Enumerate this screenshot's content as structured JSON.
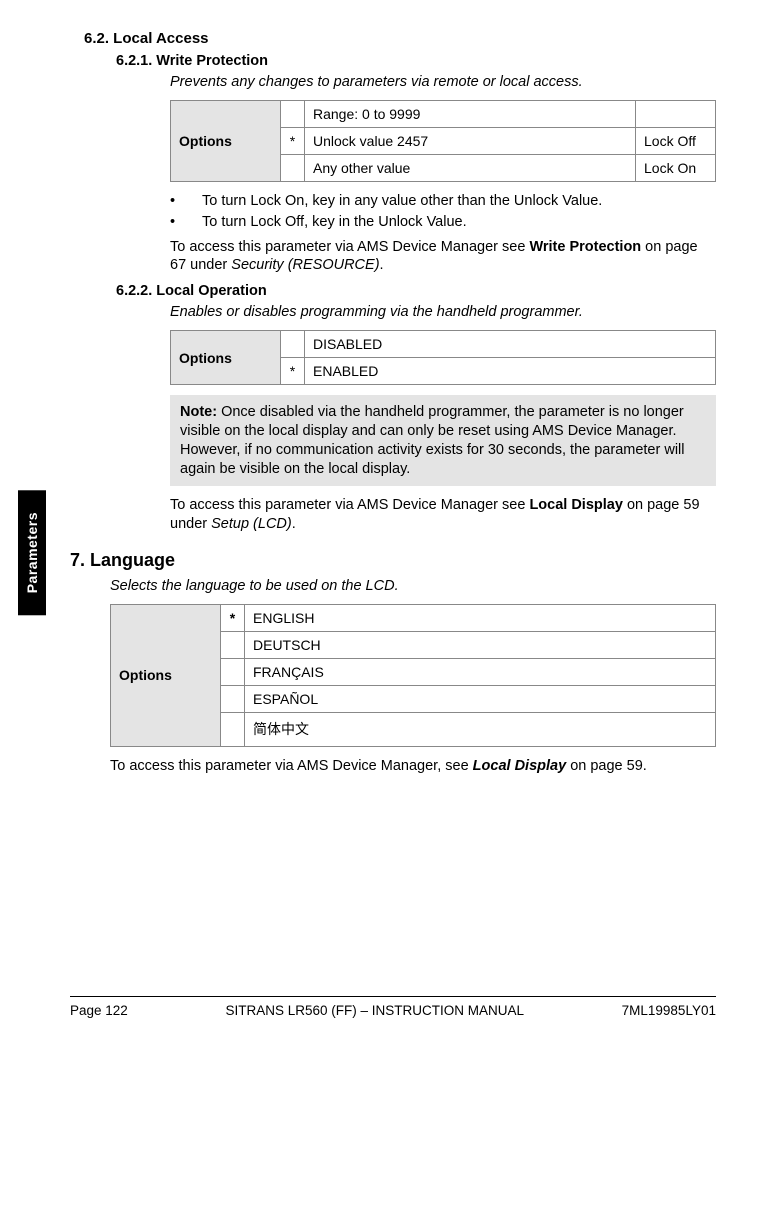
{
  "sideTab": "Parameters",
  "sec62": {
    "heading": "6.2.  Local Access",
    "sub621": {
      "heading": "6.2.1.  Write Protection",
      "desc": "Prevents any changes to parameters via remote or local access.",
      "optionsLabel": "Options",
      "row1": {
        "range": "Range: 0 to 9999"
      },
      "row2": {
        "star": "*",
        "val": "Unlock value 2457",
        "eff": "Lock Off"
      },
      "row3": {
        "val": "Any other value",
        "eff": "Lock On"
      },
      "bullet1": "To turn Lock On, key in any value other than the Unlock Value.",
      "bullet2": "To turn Lock Off, key in the Unlock Value.",
      "access_pre": "To access this parameter via AMS Device Manager see ",
      "access_link": "Write Protection",
      "access_mid": " on page 67 under ",
      "access_ital": "Security (RESOURCE)",
      "access_post": "."
    },
    "sub622": {
      "heading": "6.2.2.  Local Operation",
      "desc": "Enables or disables programming via the handheld programmer.",
      "optionsLabel": "Options",
      "row1": {
        "val": "DISABLED"
      },
      "row2": {
        "star": "*",
        "val": "ENABLED"
      },
      "note_label": "Note:",
      "note_text": " Once disabled via the handheld programmer, the parameter is no longer visible on the local display and can only be reset using AMS Device Manager. However, if no communication activity exists for 30 seconds, the parameter will again be visible on the local display.",
      "access_pre": "To access this parameter via AMS Device Manager see ",
      "access_link": "Local Display",
      "access_mid": " on page 59 under ",
      "access_ital": "Setup (LCD)",
      "access_post": "."
    }
  },
  "sec7": {
    "heading": "7.    Language",
    "desc": "Selects the language to be used on the LCD.",
    "optionsLabel": "Options",
    "row1": {
      "star": "*",
      "val": "ENGLISH"
    },
    "row2": {
      "val": "DEUTSCH"
    },
    "row3": {
      "val": "FRANÇAIS"
    },
    "row4": {
      "val": "ESPAÑOL"
    },
    "row5": {
      "val": "简体中文"
    },
    "access_pre": "To access this parameter via AMS Device Manager, see ",
    "access_link": "Local Display ",
    "access_post": "  on page 59."
  },
  "footer": {
    "left": "Page 122",
    "center": "SITRANS LR560 (FF) – INSTRUCTION MANUAL",
    "right": "7ML19985LY01"
  }
}
